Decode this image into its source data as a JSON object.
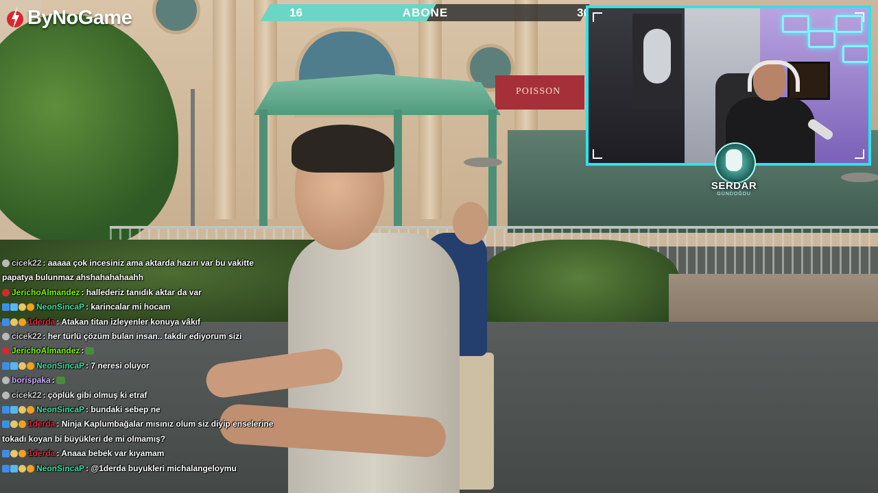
{
  "logo": {
    "text": "ByNoGame",
    "icon": "bynogame-logo-icon"
  },
  "subscriber_goal": {
    "current": "16",
    "label": "ABONE",
    "target": "30",
    "progress_fraction": 0.533,
    "fill_color": "#6bd5c6"
  },
  "webcam": {
    "border_color": "#2ee2ee"
  },
  "streamer_badge": {
    "name": "SERDAR",
    "subtitle": "GÜNDOĞDU"
  },
  "chat": {
    "messages": [
      {
        "user": "cicek22",
        "color": "#d0d0d0",
        "badges": [
          "grey-dot"
        ],
        "text": ": aaaaa çok incesiniz ama aktarda hazırı var bu vakitte papatya bulunmaz ahshahahahaahh"
      },
      {
        "user": "JerichoAlmandez",
        "color": "#7cfc00",
        "badges": [
          "red-dot"
        ],
        "text": ": hallederiz tanıdık aktar da var"
      },
      {
        "user": "NeonSincaP",
        "color": "#3fe0a0",
        "badges": [
          "blue-square",
          "gem",
          "sparkle",
          "gold-coin"
        ],
        "text": ": karincalar mi hocam"
      },
      {
        "user": "1derda",
        "color": "#e0253a",
        "badges": [
          "blue-square",
          "sparkle",
          "gold-coin"
        ],
        "text": ": Atakan titan izleyenler konuya vâkıf"
      },
      {
        "user": "cicek22",
        "color": "#d0d0d0",
        "badges": [
          "grey-dot"
        ],
        "text": ": her türlü çözüm bulan insan.. takdir ediyorum sizi"
      },
      {
        "user": "JerichoAlmandez",
        "color": "#7cfc00",
        "badges": [
          "red-dot"
        ],
        "text": ":",
        "emote": "frog-emote"
      },
      {
        "user": "NeonSincaP",
        "color": "#3fe0a0",
        "badges": [
          "blue-square",
          "gem",
          "sparkle",
          "gold-coin"
        ],
        "text": ": 7 neresi oluyor"
      },
      {
        "user": "borispaka",
        "color": "#d0b0ff",
        "badges": [
          "grey-dot"
        ],
        "text": ":",
        "emote": "frog-emote"
      },
      {
        "user": "cicek22",
        "color": "#d0d0d0",
        "badges": [
          "grey-dot"
        ],
        "text": ": çöplük gibi olmuş ki etraf"
      },
      {
        "user": "NeonSincaP",
        "color": "#3fe0a0",
        "badges": [
          "blue-square",
          "gem",
          "sparkle",
          "gold-coin"
        ],
        "text": ": bundaki sebep ne"
      },
      {
        "user": "1derda",
        "color": "#e0253a",
        "badges": [
          "blue-square",
          "sparkle",
          "gold-coin"
        ],
        "text": ": Ninja Kaplumbağalar mısınız olum siz diyip enselerine tokadı koyan bi büyükleri de mi olmamış?"
      },
      {
        "user": "1derda",
        "color": "#e0253a",
        "badges": [
          "blue-square",
          "sparkle",
          "gold-coin"
        ],
        "text": ": Anaaa bebek var kıyamam"
      },
      {
        "user": "NeonSincaP",
        "color": "#3fe0a0",
        "badges": [
          "blue-square",
          "gem",
          "sparkle",
          "gold-coin"
        ],
        "text": ": @1derda buyukleri michalangeloymu"
      }
    ]
  }
}
